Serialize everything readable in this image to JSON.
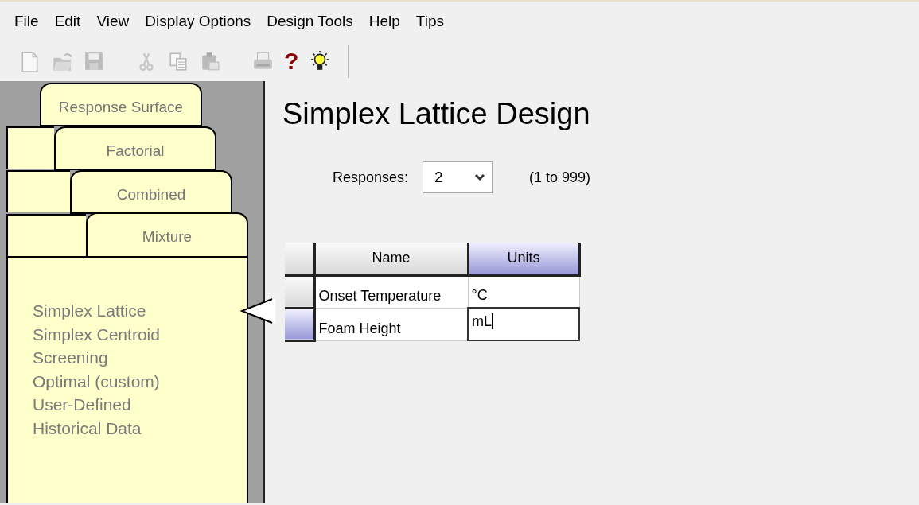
{
  "menu": [
    "File",
    "Edit",
    "View",
    "Display Options",
    "Design Tools",
    "Help",
    "Tips"
  ],
  "toolbar": [
    {
      "kind": "new",
      "disabled": true
    },
    {
      "kind": "open",
      "disabled": true
    },
    {
      "kind": "save",
      "disabled": true
    },
    {
      "kind": "gap"
    },
    {
      "kind": "cut",
      "disabled": true
    },
    {
      "kind": "copy",
      "disabled": true
    },
    {
      "kind": "paste",
      "disabled": true
    },
    {
      "kind": "gap"
    },
    {
      "kind": "print",
      "disabled": true
    },
    {
      "kind": "help",
      "text": "?",
      "disabled": false
    },
    {
      "kind": "tip",
      "disabled": false
    }
  ],
  "design_tabs": [
    {
      "label": "Response Surface",
      "selected": false
    },
    {
      "label": "Factorial",
      "selected": false
    },
    {
      "label": "Combined",
      "selected": false
    },
    {
      "label": "Mixture",
      "selected": true,
      "items": [
        {
          "label": "Simplex Lattice",
          "selected": true
        },
        {
          "label": "Simplex Centroid",
          "selected": false
        },
        {
          "label": "Screening",
          "selected": false
        },
        {
          "label": "Optimal (custom)",
          "selected": false
        },
        {
          "label": "User-Defined",
          "selected": false
        },
        {
          "label": "Historical Data",
          "selected": false
        }
      ]
    }
  ],
  "title": "Simplex Lattice Design",
  "responses": {
    "label": "Responses:",
    "value": "2",
    "range": "(1 to 999)"
  },
  "grid": {
    "columns": [
      {
        "label": "Name",
        "selected": false
      },
      {
        "label": "Units",
        "selected": true
      }
    ],
    "rows": [
      {
        "cells": [
          {
            "text": "Onset Temperature",
            "editing": false
          },
          {
            "text": "°C",
            "editing": false
          }
        ],
        "selected": false
      },
      {
        "cells": [
          {
            "text": "Foam Height",
            "editing": false
          },
          {
            "text": "mL",
            "editing": true
          }
        ],
        "selected": true
      }
    ]
  }
}
